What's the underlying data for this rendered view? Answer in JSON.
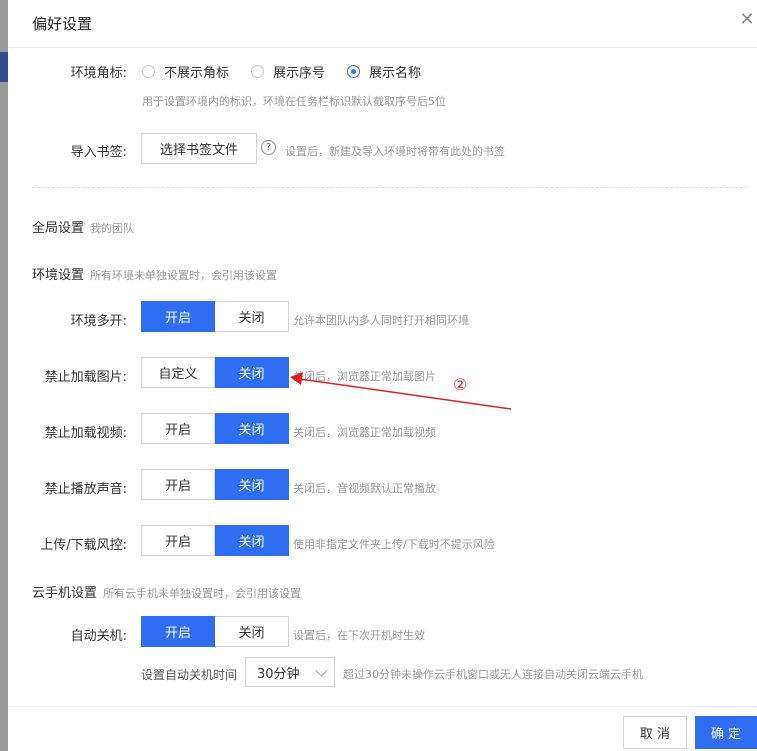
{
  "dialog": {
    "title": "偏好设置"
  },
  "env_badge": {
    "label": "环境角标:",
    "options": [
      "不展示角标",
      "展示序号",
      "展示名称"
    ],
    "selected_index": 2,
    "hint": "用于设置环境内的标识，环境在任务栏标识默认截取序号后5位"
  },
  "bookmark": {
    "label": "导入书签:",
    "button": "选择书签文件",
    "help_icon": "?",
    "hint": "设置后，新建及导入环境时将带有此处的书签"
  },
  "global": {
    "title": "全局设置",
    "sub": "我的团队"
  },
  "env_settings": {
    "title": "环境设置",
    "sub": "所有环境未单独设置时，会引用该设置"
  },
  "rows": [
    {
      "label": "环境多开:",
      "options": [
        "开启",
        "关闭"
      ],
      "active": 0,
      "hint": "允许本团队内多人同时打开相同环境"
    },
    {
      "label": "禁止加载图片:",
      "options": [
        "自定义",
        "关闭"
      ],
      "active": 1,
      "hint": "关闭后，浏览器正常加载图片"
    },
    {
      "label": "禁止加载视频:",
      "options": [
        "开启",
        "关闭"
      ],
      "active": 1,
      "hint": "关闭后，浏览器正常加载视频"
    },
    {
      "label": "禁止播放声音:",
      "options": [
        "开启",
        "关闭"
      ],
      "active": 1,
      "hint": "关闭后，音视频默认正常播放"
    },
    {
      "label": "上传/下载风控:",
      "options": [
        "开启",
        "关闭"
      ],
      "active": 1,
      "hint": "使用非指定文件夹上传/下载时不提示风险"
    }
  ],
  "cloud_phone": {
    "title": "云手机设置",
    "sub": "所有云手机未单独设置时，会引用该设置"
  },
  "auto_shutdown": {
    "label": "自动关机:",
    "options": [
      "开启",
      "关闭"
    ],
    "active": 0,
    "hint": "设置后，在下次开机时生效",
    "time_label": "设置自动关机时间",
    "time_value": "30分钟",
    "time_hint": "超过30分钟未操作云手机窗口或无人连接自动关闭云端云手机"
  },
  "footer": {
    "cancel": "取 消",
    "ok": "确 定"
  },
  "annotation": {
    "number": "②",
    "color": "#e02020"
  },
  "colors": {
    "accent": "#2f6df2"
  }
}
